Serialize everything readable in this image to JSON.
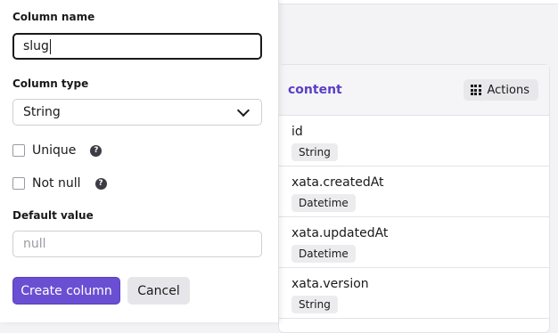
{
  "form": {
    "column_name_label": "Column name",
    "column_name_value": "slug",
    "column_type_label": "Column type",
    "column_type_value": "String",
    "unique_label": "Unique",
    "not_null_label": "Not null",
    "help_glyph": "?",
    "default_value_label": "Default value",
    "default_value_placeholder": "null",
    "create_button": "Create column",
    "cancel_button": "Cancel"
  },
  "table": {
    "title": "content",
    "actions_label": "Actions",
    "columns": [
      {
        "name": "id",
        "type": "String"
      },
      {
        "name": "xata.createdAt",
        "type": "Datetime"
      },
      {
        "name": "xata.updatedAt",
        "type": "Datetime"
      },
      {
        "name": "xata.version",
        "type": "String"
      }
    ]
  },
  "colors": {
    "primary": "#6b4fd2",
    "table_title": "#5b3fc4"
  }
}
